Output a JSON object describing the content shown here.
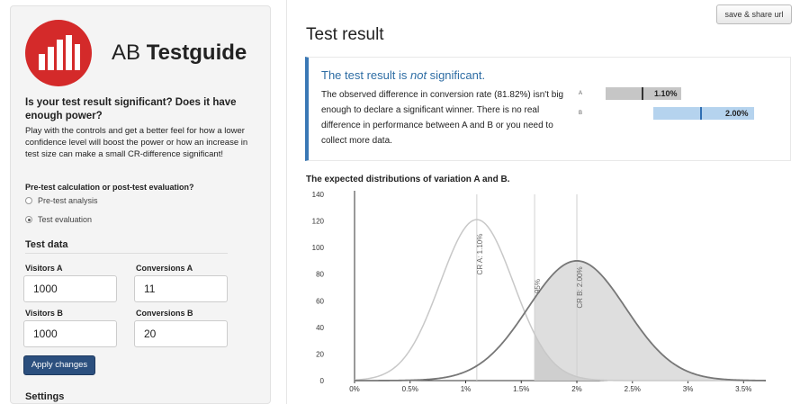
{
  "sidebar": {
    "logo_light": "AB ",
    "logo_bold": "Testguide",
    "question": "Is your test result significant? Does it have enough power?",
    "description": "Play with the controls and get a better feel for how a lower confidence level will boost the power or how an increase in test size can make a small CR-difference significant!",
    "calc_label": "Pre-test calculation or post-test evaluation?",
    "radio_pre": "Pre-test analysis",
    "radio_eval": "Test evaluation",
    "selected_mode": "Test evaluation",
    "test_data_title": "Test data",
    "visitors_a_label": "Visitors A",
    "visitors_a": "1000",
    "conversions_a_label": "Conversions A",
    "conversions_a": "11",
    "visitors_b_label": "Visitors B",
    "visitors_b": "1000",
    "conversions_b_label": "Conversions B",
    "conversions_b": "20",
    "apply_label": "Apply changes",
    "settings_title": "Settings"
  },
  "header": {
    "share_label": "save & share url",
    "title": "Test result"
  },
  "result": {
    "head_pre": "The test result is ",
    "head_em": "not",
    "head_post": " significant.",
    "body": "The observed difference in conversion rate (81.82%) isn't big enough to declare a significant winner. There is no real difference in performance between A and B or you need to collect more data.",
    "bar_a_label": "A",
    "bar_a_value": "1.10%",
    "bar_b_label": "B",
    "bar_b_value": "2.00%"
  },
  "colors": {
    "accent": "#3a78b5",
    "bar_a": "#c6c6c6",
    "bar_b": "#b5d3ee",
    "brand_red": "#d42a2a",
    "button": "#2b4f7e"
  },
  "chart_title": "The expected distributions of variation A and B.",
  "chart_data": {
    "type": "area",
    "x_ticks": [
      "0%",
      "0.5%",
      "1%",
      "1.5%",
      "2%",
      "2.5%",
      "3%",
      "3.5%"
    ],
    "y_ticks": [
      "0",
      "20",
      "40",
      "60",
      "80",
      "100",
      "120",
      "140"
    ],
    "xlim": [
      0,
      3.7
    ],
    "ylim": [
      0,
      140
    ],
    "series": [
      {
        "name": "CR A: 1.10%",
        "mean": 1.1,
        "peak": 121,
        "sd": 0.33,
        "color": "#c8c8c8"
      },
      {
        "name": "CR B: 2.00%",
        "mean": 2.0,
        "peak": 90,
        "sd": 0.44,
        "color": "#777777"
      }
    ],
    "threshold": {
      "x": 1.62,
      "label": "95%"
    },
    "annotations": [
      "CR A: 1.10%",
      "CR B: 2.00%",
      "95%"
    ]
  }
}
